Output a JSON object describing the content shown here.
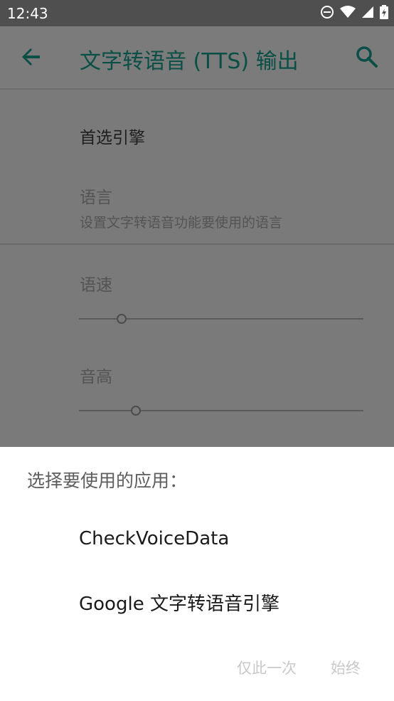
{
  "status_bar": {
    "time": "12:43"
  },
  "toolbar": {
    "title": "文字转语音 (TTS) 输出"
  },
  "settings": {
    "preferred_engine": "首选引擎",
    "language_title": "语言",
    "language_summary": "设置文字转语音功能要使用的语言",
    "speech_rate": "语速",
    "pitch": "音高",
    "speech_rate_level": 0.15,
    "pitch_level": 0.2
  },
  "chooser": {
    "prompt": "选择要使用的应用：",
    "apps": [
      "CheckVoiceData",
      "Google 文字转语音引擎"
    ],
    "just_once": "仅此一次",
    "always": "始终"
  },
  "colors": {
    "accent": "#0a4f46"
  }
}
